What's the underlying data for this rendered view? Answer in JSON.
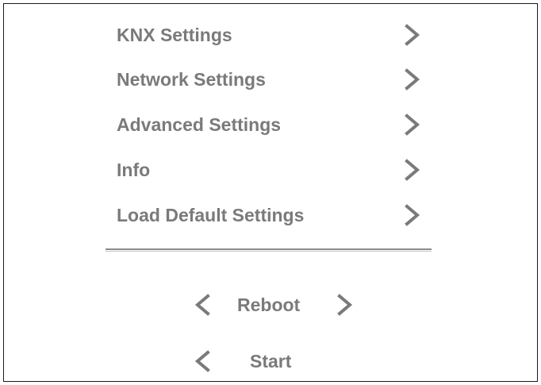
{
  "menu": {
    "items": [
      {
        "label": "KNX Settings"
      },
      {
        "label": "Network Settings"
      },
      {
        "label": "Advanced Settings"
      },
      {
        "label": "Info"
      },
      {
        "label": "Load Default Settings"
      }
    ]
  },
  "nav": {
    "reboot_label": "Reboot",
    "start_label": "Start"
  },
  "icons": {
    "chevron_right": "chevron-right-icon",
    "chevron_left": "chevron-left-icon"
  },
  "colors": {
    "text": "#7a7a7a",
    "chevron": "#7a7a7a",
    "border": "#1a1a1a",
    "background": "#ffffff"
  }
}
